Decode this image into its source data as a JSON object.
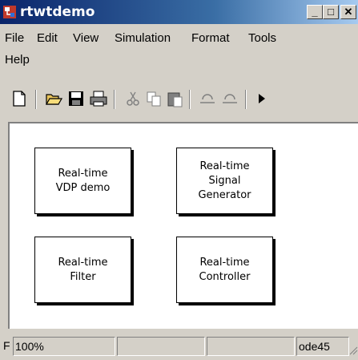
{
  "window": {
    "title": "rtwtdemo",
    "icon": "simulink-model-icon",
    "controls": {
      "minimize": "_",
      "maximize": "□",
      "close": "✕"
    }
  },
  "menu": {
    "items": [
      "File",
      "Edit",
      "View",
      "Simulation",
      "Format",
      "Tools",
      "Help"
    ]
  },
  "toolbar": {
    "tools": [
      "new-icon",
      "open-icon",
      "save-icon",
      "print-icon",
      "cut-icon",
      "copy-icon",
      "paste-icon",
      "undo-icon",
      "redo-icon",
      "play-icon"
    ]
  },
  "blocks": [
    {
      "label": "Real-time\nVDP demo"
    },
    {
      "label": "Real-time\nSignal\nGenerator"
    },
    {
      "label": "Real-time\nFilter"
    },
    {
      "label": "Real-time\nController"
    }
  ],
  "statusbar": {
    "left": "F",
    "zoom": "100%",
    "cell2": "",
    "cell3": "",
    "solver": "ode45"
  },
  "colors": {
    "titlebar_start": "#0a246a",
    "titlebar_end": "#a6caf0",
    "chrome": "#d4d0c8",
    "canvas": "#ffffff"
  }
}
